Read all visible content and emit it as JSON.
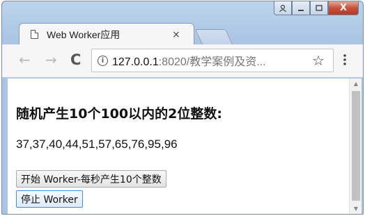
{
  "window": {
    "caption": {
      "user": "♍",
      "minimize": "—",
      "maximize": "□",
      "close": "X"
    }
  },
  "tab": {
    "title": "Web Worker应用",
    "close": "×"
  },
  "toolbar": {
    "back": "←",
    "forward": "→",
    "reload": "C",
    "info": "i",
    "url_host": "127.0.0.1",
    "url_path": ":8020/教学案例及资...",
    "star": "☆",
    "menu": "⋮"
  },
  "page": {
    "heading": "随机产生10个100以内的2位整数:",
    "result": "37,37,40,44,51,57,65,76,95,96",
    "start_button": "开始 Worker-每秒产生10个整数",
    "stop_button": "停止 Worker"
  },
  "scrollbar": {
    "up": "▲",
    "down": "▼"
  }
}
